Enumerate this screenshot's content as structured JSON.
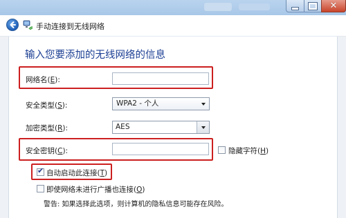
{
  "window": {
    "minimize_glyph": "",
    "maximize_glyph": "",
    "close_glyph": "✕"
  },
  "header": {
    "title": "手动连接到无线网络",
    "back_icon": "back-arrow-icon",
    "app_icon": "wireless-network-icon"
  },
  "page": {
    "heading": "输入您要添加的无线网络的信息"
  },
  "form": {
    "network_name": {
      "label": "网络名",
      "accel": "E",
      "value": ""
    },
    "security_type": {
      "label": "安全类型",
      "accel": "S",
      "selected": "WPA2 - 个人"
    },
    "encryption_type": {
      "label": "加密类型",
      "accel": "R",
      "selected": "AES"
    },
    "security_key": {
      "label": "安全密钥",
      "accel": "C",
      "value": ""
    },
    "hide_chars": {
      "label": "隐藏字符",
      "accel": "H",
      "checked": false
    },
    "auto_start": {
      "label": "自动启动此连接",
      "accel": "T",
      "checked": true
    },
    "connect_if_not_broadcasting": {
      "label": "即使网络未进行广播也连接",
      "accel": "O",
      "checked": false
    },
    "warning": "警告: 如果选择此选项，则计算机的隐私信息可能存在风险。"
  },
  "colors": {
    "highlight_box": "#cc1f1f",
    "heading": "#1c3f94",
    "title_bar": "#b9d3ee",
    "close_button": "#c9442b"
  }
}
